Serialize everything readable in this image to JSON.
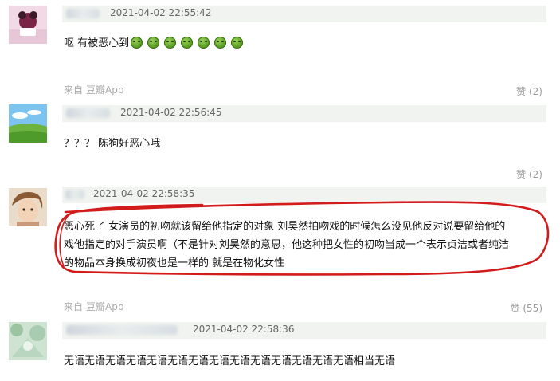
{
  "comments": [
    {
      "timestamp": "2021-04-02 22:55:42",
      "text": "呕 有被恶心到",
      "emoji_icon": "nauseated-emoji-icon",
      "emoji_count": 7,
      "source_prefix": "来自",
      "source_app": "豆瓣App",
      "like_label": "赞 (2)"
    },
    {
      "timestamp": "2021-04-02 22:56:45",
      "text": "？？？ 陈狗好恶心哦",
      "like_label": "赞 (2)"
    },
    {
      "timestamp": "2021-04-02 22:58:35",
      "text_lines": [
        "恶心死了 女演员的初吻就该留给他指定的对象 刘昊然拍吻戏的时候怎么没见他反对说要留给他的",
        "戏他指定的对手演员啊（不是针对刘昊然的意思，他这种把女性的初吻当成一个表示贞洁或者纯洁",
        "的物品本身换成初夜也是一样的 就是在物化女性"
      ],
      "source_prefix": "来自",
      "source_app": "豆瓣App",
      "like_label": "赞 (55)",
      "annotation_color": "#d21b1b"
    },
    {
      "timestamp": "2021-04-02 22:58:36",
      "text": "无语无语无语无语无语无语无语无语无语无语无语无语无语无语相当无语"
    }
  ],
  "colors": {
    "meta_bar_bg": "#f0f3ef",
    "timestamp": "#666666",
    "muted": "#aaaaaa",
    "annotation": "#d21b1b"
  }
}
